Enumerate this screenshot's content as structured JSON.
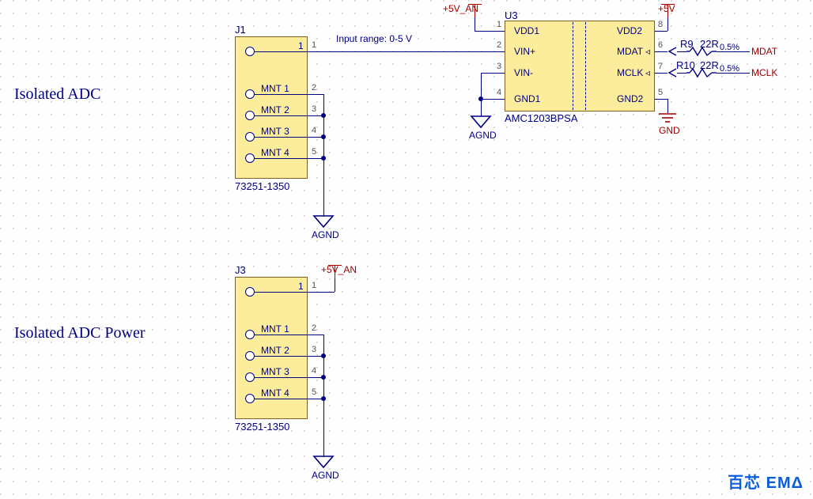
{
  "titles": {
    "adc": "Isolated ADC",
    "power": "Isolated ADC Power"
  },
  "annot_input_range": "Input range: 0-5 V",
  "watermark": "百芯 EMΔ",
  "nets": {
    "p5v_an": "+5V_AN",
    "p5v": "+5V",
    "agnd": "AGND",
    "gnd": "GND",
    "mdat": "MDAT",
    "mclk": "MCLK"
  },
  "j1": {
    "ref": "J1",
    "part": "73251-1350",
    "pins": {
      "main": {
        "num": "1",
        "label": "1"
      },
      "m1": {
        "name": "MNT 1",
        "num": "2"
      },
      "m2": {
        "name": "MNT 2",
        "num": "3"
      },
      "m3": {
        "name": "MNT 3",
        "num": "4"
      },
      "m4": {
        "name": "MNT 4",
        "num": "5"
      }
    }
  },
  "j3": {
    "ref": "J3",
    "part": "73251-1350",
    "pins": {
      "main": {
        "num": "1",
        "label": "1"
      },
      "m1": {
        "name": "MNT 1",
        "num": "2"
      },
      "m2": {
        "name": "MNT 2",
        "num": "3"
      },
      "m3": {
        "name": "MNT 3",
        "num": "4"
      },
      "m4": {
        "name": "MNT 4",
        "num": "5"
      }
    }
  },
  "u3": {
    "ref": "U3",
    "part": "AMC1203BPSA",
    "left": {
      "vdd1": {
        "num": "1",
        "name": "VDD1"
      },
      "vinp": {
        "num": "2",
        "name": "VIN+"
      },
      "vinn": {
        "num": "3",
        "name": "VIN-"
      },
      "gnd1": {
        "num": "4",
        "name": "GND1"
      }
    },
    "right": {
      "vdd2": {
        "num": "8",
        "name": "VDD2"
      },
      "mdat": {
        "num": "6",
        "name": "MDAT"
      },
      "mclk": {
        "num": "7",
        "name": "MCLK"
      },
      "gnd2": {
        "num": "5",
        "name": "GND2"
      }
    }
  },
  "r9": {
    "ref": "R9",
    "value": "22R",
    "tol": "0.5%"
  },
  "r10": {
    "ref": "R10",
    "value": "22R",
    "tol": "0.5%"
  }
}
